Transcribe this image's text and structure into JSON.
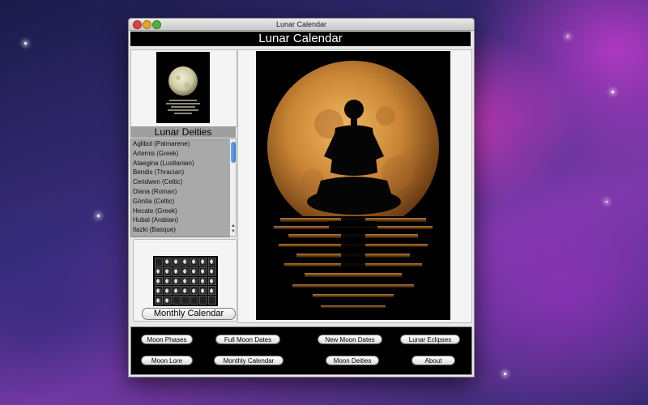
{
  "window": {
    "title": "Lunar Calendar"
  },
  "header": {
    "title": "Lunar Calendar"
  },
  "deities": {
    "title": "Lunar Deities",
    "items": [
      "Aglibol (Palmarene)",
      "Artemis (Greek)",
      "Ataegina (Lusitanian)",
      "Bendis (Thracian)",
      "Ceridwen (Celtic)",
      "Diana (Roman)",
      "Gòntia (Celtic)",
      "Hecate (Greek)",
      "Hubal (Arabian)",
      "Ilazki (Basque)"
    ]
  },
  "calendar_panel": {
    "button_label": "Monthly Calendar"
  },
  "bottom_buttons": {
    "moon_phases": "Moon Phases",
    "full_moon_dates": "Full Moon Dates",
    "new_moon_dates": "New Moon Dates",
    "lunar_eclipses": "Lunar Eclipses",
    "moon_lore": "Moon Lore",
    "monthly_calendar": "Monthly Calendar",
    "moon_deities": "Moon Deities",
    "about": "About"
  }
}
